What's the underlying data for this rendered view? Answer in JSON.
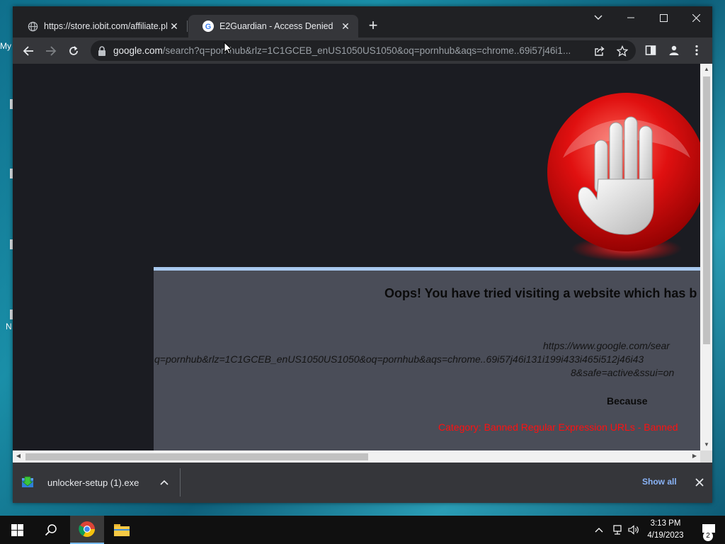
{
  "desktop": {
    "fragments": [
      "My",
      "N"
    ]
  },
  "browser": {
    "tabs": [
      {
        "title": "https://store.iobit.com/affiliate.ph",
        "favicon": "globe-icon",
        "active": false
      },
      {
        "title": "E2Guardian - Access Denied",
        "favicon": "google-icon",
        "active": true
      }
    ],
    "address_bar": {
      "host": "google.com",
      "path": "/search?q=pornhub&rlz=1C1GCEB_enUS1050US1050&oq=pornhub&aqs=chrome..69i57j46i1..."
    },
    "colors": {
      "frame": "#202124",
      "toolbar": "#35363a",
      "link": "#8ab4f8"
    }
  },
  "page": {
    "heading": "Oops! You have tried visiting a website which has b",
    "blocked_url_lines": [
      "https://www.google.com/sear",
      "q=pornhub&rlz=1C1GCEB_enUS1050US1050&oq=pornhub&aqs=chrome..69i57j46i131i199i433i465i512j46i43",
      "8&safe=active&ssui=on"
    ],
    "because_label": "Because",
    "category_text": "Category: Banned Regular Expression URLs - Banned",
    "colors": {
      "background": "#1b1c22",
      "panel": "#4a4d58",
      "panel_border": "#a8c8ee",
      "category": "#ff1010",
      "stop_sign": "#e01010"
    }
  },
  "downloads": {
    "file_name": "unlocker-setup (1).exe",
    "show_all_label": "Show all"
  },
  "taskbar": {
    "time": "3:13 PM",
    "date": "4/19/2023",
    "notification_count": "2"
  }
}
